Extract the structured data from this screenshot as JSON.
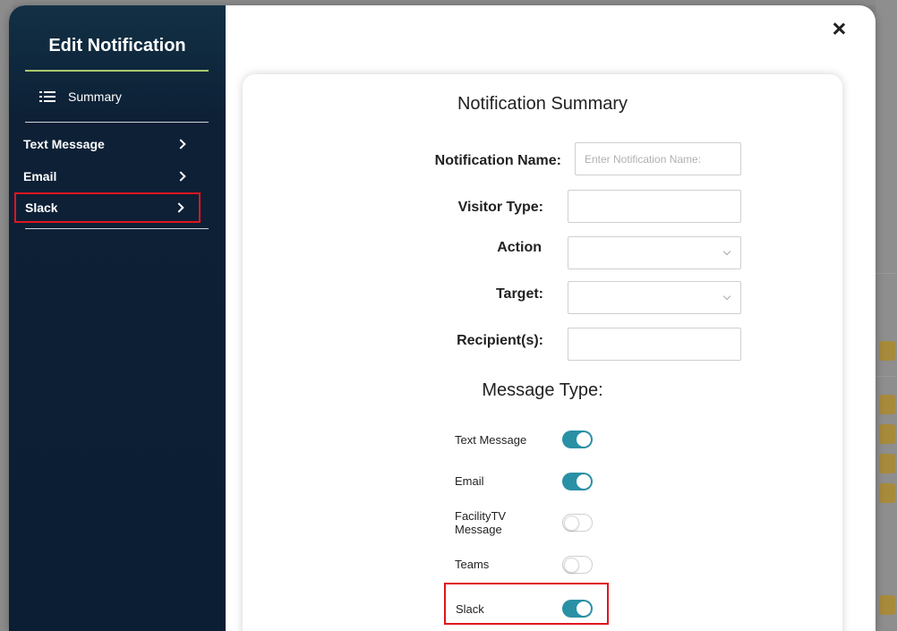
{
  "sidebar": {
    "title": "Edit Notification",
    "summary_label": "Summary",
    "items": [
      {
        "label": "Text Message"
      },
      {
        "label": "Email"
      },
      {
        "label": "Slack"
      }
    ]
  },
  "summary": {
    "title": "Notification Summary",
    "fields": {
      "name_label": "Notification Name:",
      "name_placeholder": "Enter Notification Name:",
      "visitor_type_label": "Visitor Type:",
      "action_label": "Action",
      "target_label": "Target:",
      "recipients_label": "Recipient(s):"
    },
    "message_type": {
      "title": "Message Type:",
      "options": [
        {
          "label": "Text Message",
          "enabled": true
        },
        {
          "label": "Email",
          "enabled": true
        },
        {
          "label": "FacilityTV Message",
          "enabled": false
        },
        {
          "label": "Teams",
          "enabled": false
        },
        {
          "label": "Slack",
          "enabled": true
        }
      ]
    }
  },
  "colors": {
    "accent": "#2a90a5",
    "sidebar_bg": "#0c1e33",
    "highlight": "#e0161e",
    "underline": "#a7c96b"
  }
}
